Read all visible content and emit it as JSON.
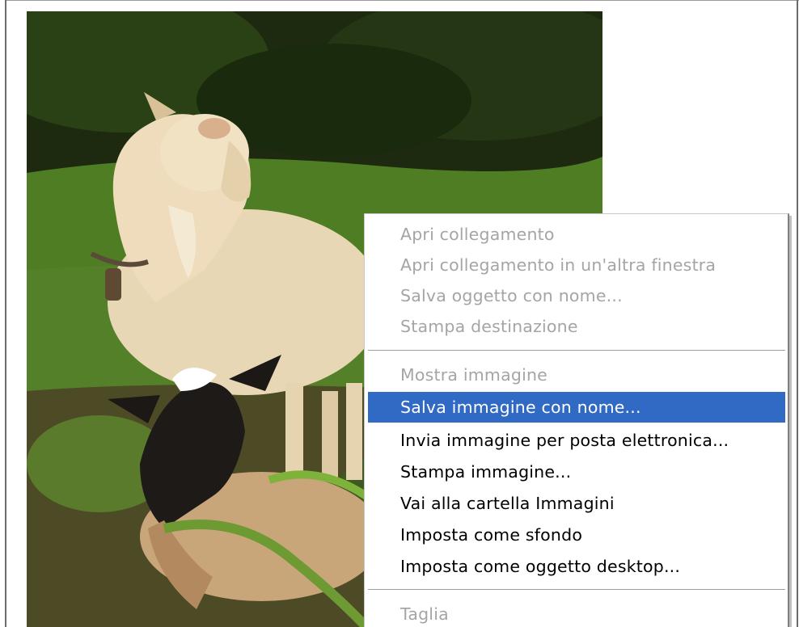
{
  "context_menu": {
    "items": [
      {
        "label": "Apri collegamento",
        "enabled": false
      },
      {
        "label": "Apri collegamento in un'altra finestra",
        "enabled": false
      },
      {
        "label": "Salva oggetto con nome...",
        "enabled": false
      },
      {
        "label": "Stampa destinazione",
        "enabled": false
      },
      {
        "label": "Mostra immagine",
        "enabled": false
      },
      {
        "label": "Salva immagine con nome...",
        "enabled": true,
        "selected": true
      },
      {
        "label": "Invia immagine per posta elettronica...",
        "enabled": true
      },
      {
        "label": "Stampa immagine...",
        "enabled": true
      },
      {
        "label": "Vai alla cartella Immagini",
        "enabled": true
      },
      {
        "label": "Imposta come sfondo",
        "enabled": true
      },
      {
        "label": "Imposta come oggetto desktop...",
        "enabled": true
      },
      {
        "label": "Taglia",
        "enabled": false
      }
    ],
    "selection_color": "#316ac5",
    "disabled_text_color": "#a5a5a5"
  },
  "photo": {
    "subject": "goats-on-grass-photo"
  }
}
